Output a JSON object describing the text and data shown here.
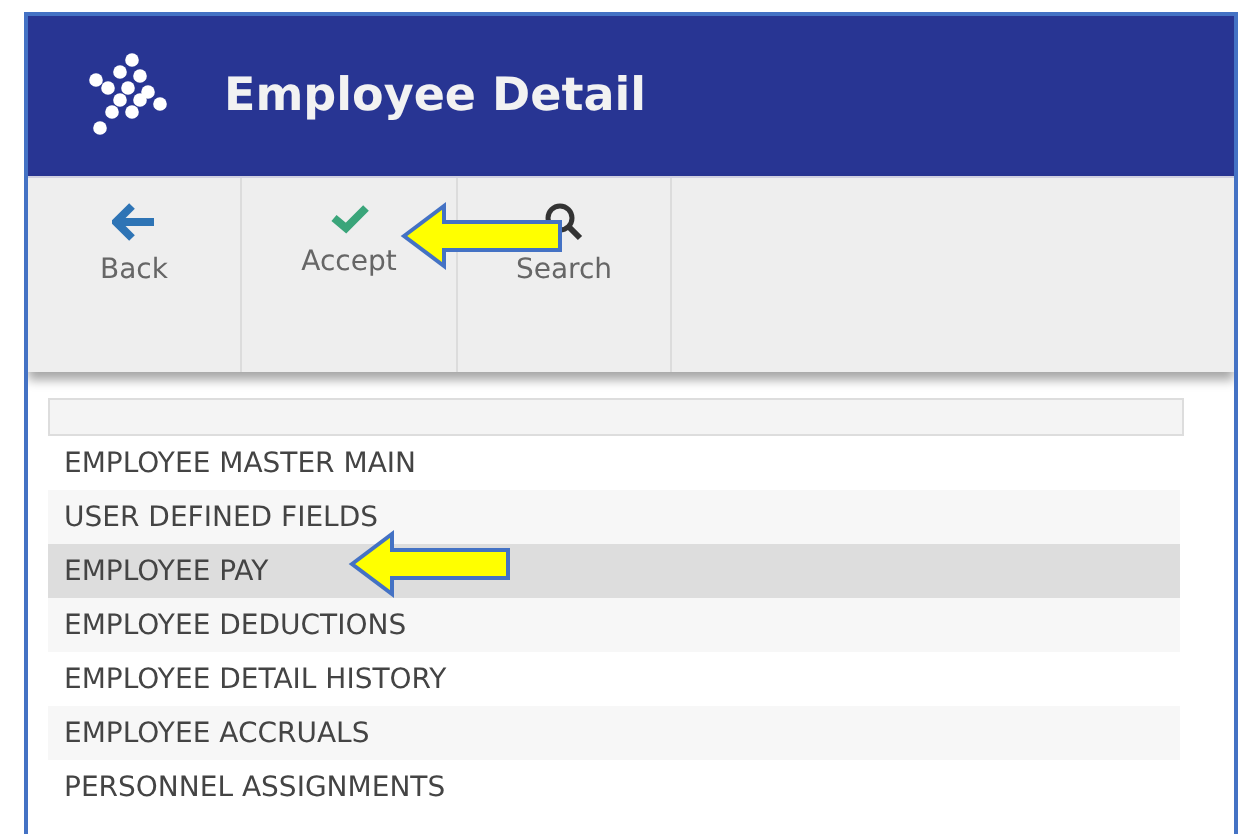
{
  "window": {
    "title": "Employee Detail"
  },
  "toolbar": [
    {
      "label": "Back",
      "kind": "back"
    },
    {
      "label": "Accept",
      "kind": "accept"
    },
    {
      "label": "Search",
      "kind": "search"
    }
  ],
  "list": {
    "items": [
      {
        "label": "EMPLOYEE MASTER MAIN",
        "selected": false
      },
      {
        "label": "USER DEFINED FIELDS",
        "selected": false
      },
      {
        "label": "EMPLOYEE PAY",
        "selected": true
      },
      {
        "label": "EMPLOYEE DEDUCTIONS",
        "selected": false
      },
      {
        "label": "EMPLOYEE DETAIL HISTORY",
        "selected": false
      },
      {
        "label": "EMPLOYEE ACCRUALS",
        "selected": false
      },
      {
        "label": "PERSONNEL ASSIGNMENTS",
        "selected": false
      }
    ]
  }
}
